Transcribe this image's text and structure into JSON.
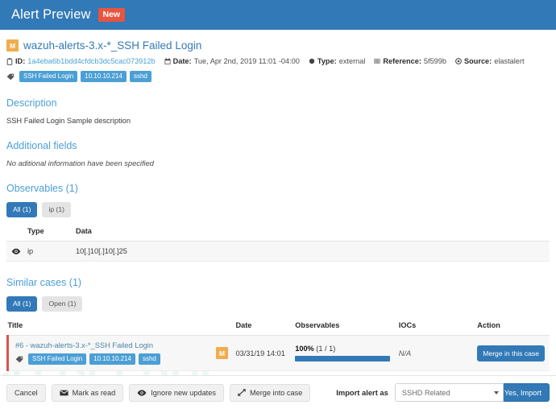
{
  "header": {
    "title": "Alert Preview",
    "badge": "New"
  },
  "alert": {
    "severity_letter": "M",
    "title": "wazuh-alerts-3.x-*_SSH Failed Login",
    "meta": [
      {
        "icon": "clipboard-icon",
        "label": "ID:",
        "value": "1a4eba6b1bdd4cfdcb3dc5cac073912b",
        "is_link": true
      },
      {
        "icon": "calendar-icon",
        "label": "Date:",
        "value": "Tue, Apr 2nd, 2019 11:01 -04:00",
        "is_link": false
      },
      {
        "icon": "circle-icon",
        "label": "Type:",
        "value": "external",
        "is_link": false
      },
      {
        "icon": "barcode-icon",
        "label": "Reference:",
        "value": "5f599b",
        "is_link": false
      },
      {
        "icon": "target-icon",
        "label": "Source:",
        "value": "elastalert",
        "is_link": false
      }
    ],
    "tags": [
      "SSH Failed Login",
      "10.10.10.214",
      "sshd"
    ]
  },
  "description": {
    "heading": "Description",
    "text": "SSH Failed Login Sample description"
  },
  "additional_fields": {
    "heading": "Additional fields",
    "text": "No aditional information have been specified"
  },
  "observables": {
    "heading": "Observables (1)",
    "filters": [
      {
        "label": "All (1)",
        "active": true
      },
      {
        "label": "ip (1)",
        "active": false
      }
    ],
    "columns": [
      "",
      "Type",
      "Data"
    ],
    "rows": [
      {
        "icon": "eye-icon",
        "type": "ip",
        "data": "10[.]10[.]10[.]25"
      }
    ]
  },
  "similar_cases": {
    "heading": "Similar cases (1)",
    "filters": [
      {
        "label": "All (1)",
        "active": true
      },
      {
        "label": "Open (1)",
        "active": false
      }
    ],
    "columns": [
      "Title",
      "",
      "Date",
      "Observables",
      "IOCs",
      "Action"
    ],
    "rows": [
      {
        "title": "#6 - wazuh-alerts-3.x-*_SSH Failed Login",
        "tags": [
          "SSH Failed Login",
          "10.10.10.214",
          "sshd"
        ],
        "severity_letter": "M",
        "date": "03/31/19 14:01",
        "observables_pct": "100%",
        "observables_ratio": "(1 / 1)",
        "observables_fill": 100,
        "iocs": "N/A",
        "action_label": "Merge in this case"
      }
    ]
  },
  "footer": {
    "cancel_label": "Cancel",
    "mark_read_label": "Mark as read",
    "mark_read_icon": "envelope-icon",
    "ignore_label": "Ignore new updates",
    "ignore_icon": "eye-icon",
    "merge_label": "Merge into case",
    "merge_icon": "arrows-merge-icon",
    "import_label": "Import alert as",
    "import_select_value": "SSHD Related",
    "import_button_label": "Yes, Import"
  },
  "watermark": {
    "text": "FREEBUF"
  },
  "colors": {
    "header_blue": "#3279b7",
    "badge_red": "#e8553f",
    "link_blue": "#4b9fd5",
    "severity_orange": "#f0ad4e",
    "case_border_red": "#d9534f",
    "tag_blue": "#4b9fd5"
  }
}
